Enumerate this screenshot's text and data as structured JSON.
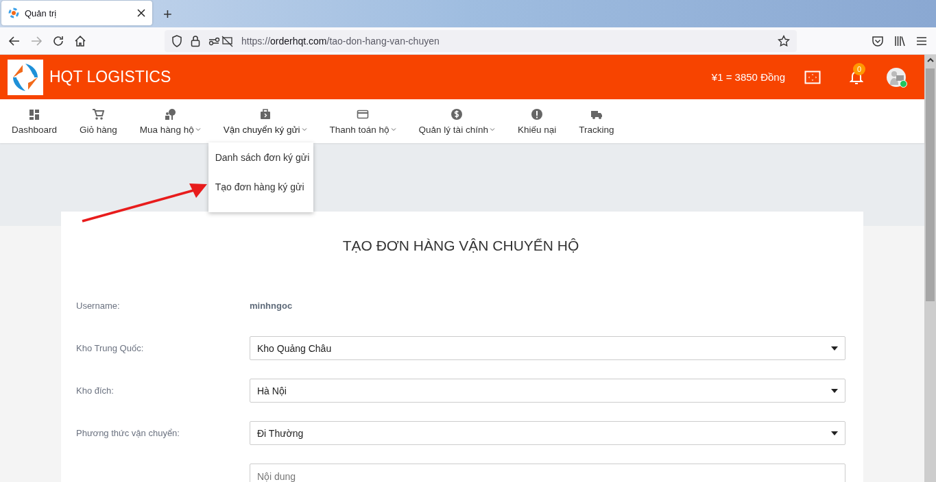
{
  "browser": {
    "tab": {
      "title": "Quản trị",
      "selected": true
    },
    "new_tab": "+",
    "url": {
      "scheme": "https://",
      "host": "orderhqt.com",
      "path": "/tao-don-hang-van-chuyen"
    }
  },
  "header": {
    "brand": "HQT LOGISTICS",
    "rate": "¥1 = 3850 Đồng",
    "notifications": "0",
    "online": true
  },
  "nav": [
    {
      "label": "Dashboard",
      "dropdown": false,
      "expanded": false
    },
    {
      "label": "Giỏ hàng",
      "dropdown": false,
      "expanded": false
    },
    {
      "label": "Mua hàng hộ",
      "dropdown": true,
      "expanded": false
    },
    {
      "label": "Vận chuyển ký gửi",
      "dropdown": true,
      "expanded": true,
      "menu": [
        "Danh sách đơn ký gửi",
        "Tạo đơn hàng ký gửi"
      ]
    },
    {
      "label": "Thanh toán hộ",
      "dropdown": true,
      "expanded": false
    },
    {
      "label": "Quản lý tài chính",
      "dropdown": true,
      "expanded": false
    },
    {
      "label": "Khiếu nại",
      "dropdown": false,
      "expanded": false
    },
    {
      "label": "Tracking",
      "dropdown": false,
      "expanded": false
    }
  ],
  "form": {
    "title": "TẠO ĐƠN HÀNG VẬN CHUYỂN HỘ",
    "fields": [
      {
        "kind": "text",
        "label": "Username:",
        "value": "minhngoc"
      },
      {
        "kind": "select",
        "label": "Kho Trung Quốc:",
        "value": "Kho Quảng Châu"
      },
      {
        "kind": "select",
        "label": "Kho đích:",
        "value": "Hà Nội"
      },
      {
        "kind": "select",
        "label": "Phương thức vận chuyển:",
        "value": "Đi Thường"
      },
      {
        "kind": "textarea",
        "placeholder": "Nội dung"
      }
    ]
  }
}
